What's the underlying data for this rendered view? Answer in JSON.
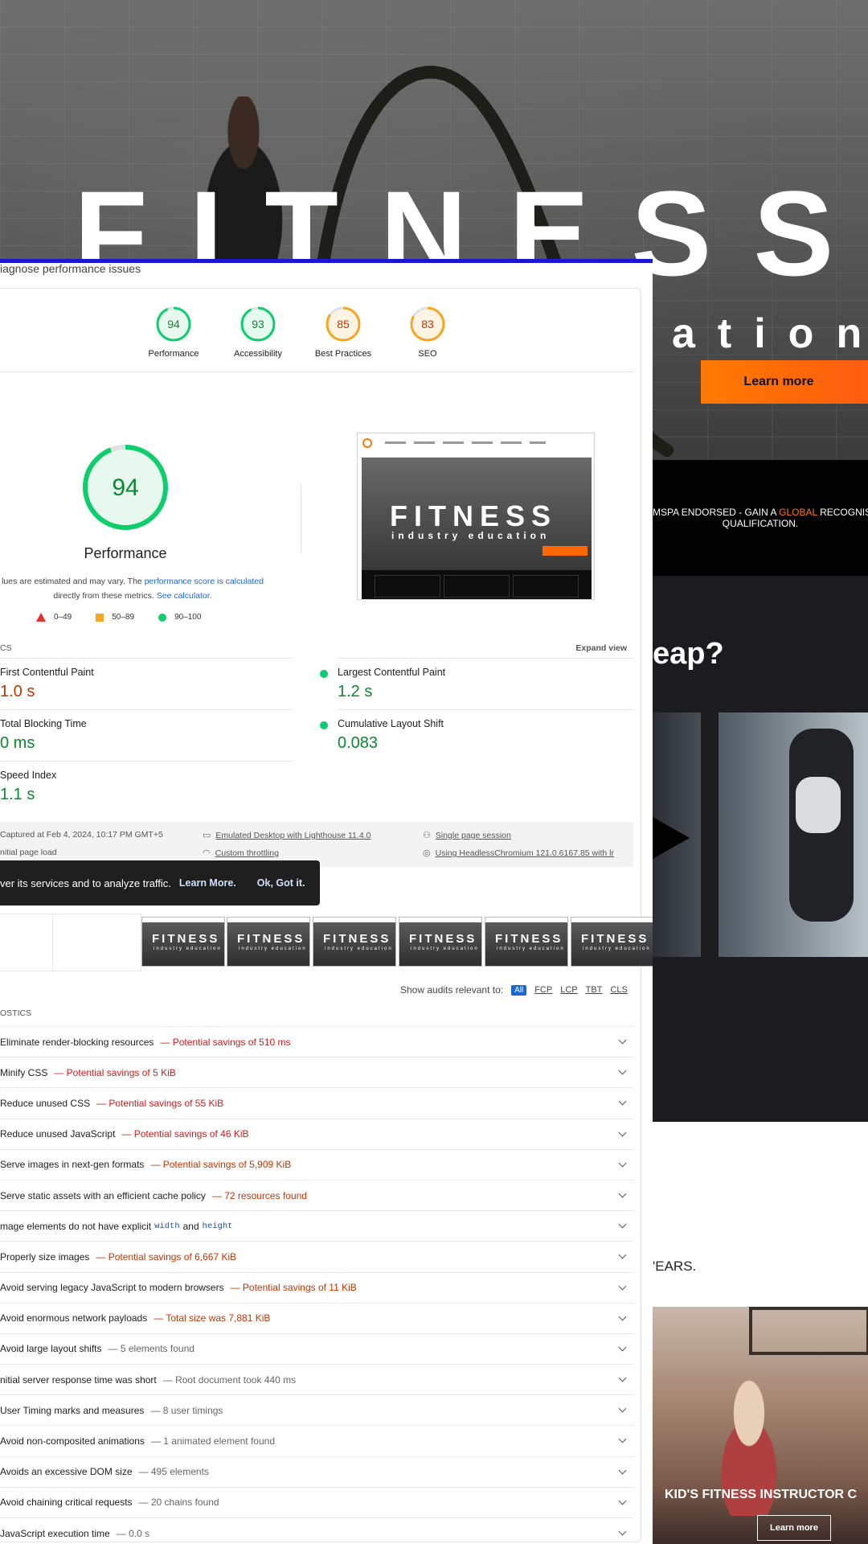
{
  "site": {
    "hero_title": "FITNESS",
    "hero_subtitle": "ation",
    "learn_more": "Learn more",
    "endorse_pre": "MSPA ENDORSED - GAIN A ",
    "endorse_hl": "GLOBAL",
    "endorse_post": " RECOGNISE",
    "endorse_line2": "QUALIFICATION.",
    "leap_text": "eap?",
    "years_text": "'EARS.",
    "kids_title": "KID'S FITNESS INSTRUCTOR C",
    "kids_button": "Learn more",
    "colors": {
      "accent": "#ff7a00",
      "dark": "#1c1c20"
    }
  },
  "lighthouse": {
    "heading": "iagnose performance issues",
    "categories": [
      {
        "label": "Performance",
        "score": "94",
        "score_num": 94,
        "color": "#0cce6b",
        "text_color": "#0a8a2e",
        "bg": "#e7f8ee"
      },
      {
        "label": "Accessibility",
        "score": "93",
        "score_num": 93,
        "color": "#0cce6b",
        "text_color": "#0a8a2e",
        "bg": "#e7f8ee"
      },
      {
        "label": "Best Practices",
        "score": "85",
        "score_num": 85,
        "color": "#f5a623",
        "text_color": "#c33300",
        "bg": "#fff4e4"
      },
      {
        "label": "SEO",
        "score": "83",
        "score_num": 83,
        "color": "#f5a623",
        "text_color": "#c33300",
        "bg": "#fff4e4"
      }
    ],
    "performance": {
      "score": "94",
      "title": "Performance",
      "note_a": "lues are estimated and may vary. The ",
      "note_link1": "performance score is calculated",
      "note_b": "directly from these metrics. ",
      "note_link2": "See calculator.",
      "legend": [
        "0–49",
        "50–89",
        "90–100"
      ]
    },
    "thumbnail": {
      "title": "FITNESS",
      "subtitle": "industry education"
    },
    "metrics_head": "CS",
    "expand_view": "Expand view",
    "metrics": [
      {
        "name": "First Contentful Paint",
        "value": "1.0 s",
        "status": "orange"
      },
      {
        "name": "Largest Contentful Paint",
        "value": "1.2 s",
        "status": "green"
      },
      {
        "name": "Total Blocking Time",
        "value": "0 ms",
        "status": "green"
      },
      {
        "name": "Cumulative Layout Shift",
        "value": "0.083",
        "status": "green"
      },
      {
        "name": "Speed Index",
        "value": "1.1 s",
        "status": "green"
      }
    ],
    "env": {
      "captured": "Captured at Feb 4, 2024, 10:17 PM GMT+5",
      "emulated": "Emulated Desktop with Lighthouse 11.4.0",
      "session": "Single page session",
      "initial": "nitial page load",
      "throttling": "Custom throttling",
      "browser": "Using HeadlessChromium 121.0.6167.85 with lr"
    },
    "cookie": {
      "text": "ver its services and to analyze traffic.",
      "learn": "Learn More.",
      "ok": "Ok, Got it."
    },
    "filmstrip": {
      "frame_title": "FITNESS",
      "frame_sub": "industry education"
    },
    "filter": {
      "label": "Show audits relevant to:",
      "options": [
        "All",
        "FCP",
        "LCP",
        "TBT",
        "CLS"
      ]
    },
    "diagnostics_head": "OSTICS",
    "audits": [
      {
        "title": "Eliminate render-blocking resources",
        "detail": "— Potential savings of 510 ms",
        "tone": "red"
      },
      {
        "title": "Minify CSS",
        "detail": "— Potential savings of 5 KiB",
        "tone": "red"
      },
      {
        "title": "Reduce unused CSS",
        "detail": "— Potential savings of 55 KiB",
        "tone": "red"
      },
      {
        "title": "Reduce unused JavaScript",
        "detail": "— Potential savings of 46 KiB",
        "tone": "red"
      },
      {
        "title": "Serve images in next-gen formats",
        "detail": "— Potential savings of 5,909 KiB",
        "tone": "orange"
      },
      {
        "title": "Serve static assets with an efficient cache policy",
        "detail": "— 72 resources found",
        "tone": "orange"
      },
      {
        "title": "mage elements do not have explicit",
        "code1": "width",
        "mid": "and",
        "code2": "height",
        "detail": "",
        "tone": "gray"
      },
      {
        "title": "Properly size images",
        "detail": "— Potential savings of 6,667 KiB",
        "tone": "orange"
      },
      {
        "title": "Avoid serving legacy JavaScript to modern browsers",
        "detail": "— Potential savings of 11 KiB",
        "tone": "orange"
      },
      {
        "title": "Avoid enormous network payloads",
        "detail": "— Total size was 7,881 KiB",
        "tone": "orange"
      },
      {
        "title": "Avoid large layout shifts",
        "detail": "— 5 elements found",
        "tone": "gray"
      },
      {
        "title": "nitial server response time was short",
        "detail": "— Root document took 440 ms",
        "tone": "gray"
      },
      {
        "title": "User Timing marks and measures",
        "detail": "— 8 user timings",
        "tone": "gray"
      },
      {
        "title": "Avoid non-composited animations",
        "detail": "— 1 animated element found",
        "tone": "gray"
      },
      {
        "title": "Avoids an excessive DOM size",
        "detail": "— 495 elements",
        "tone": "gray"
      },
      {
        "title": "Avoid chaining critical requests",
        "detail": "— 20 chains found",
        "tone": "gray"
      },
      {
        "title": "JavaScript execution time",
        "detail": "— 0.0 s",
        "tone": "gray"
      }
    ]
  }
}
